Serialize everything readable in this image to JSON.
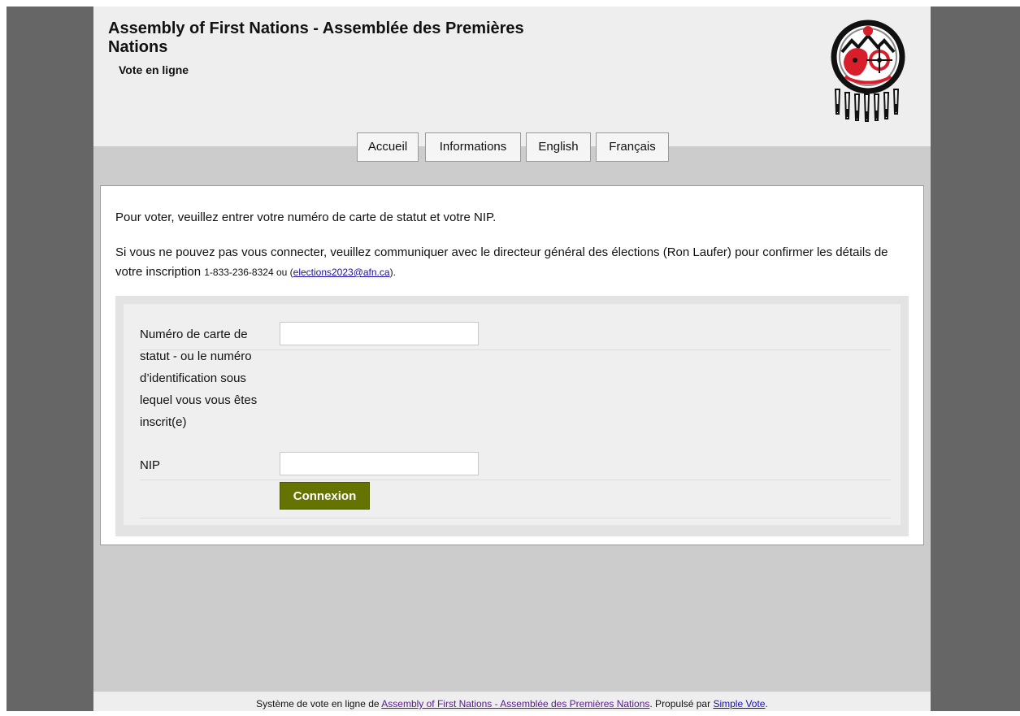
{
  "header": {
    "title": "Assembly of First Nations - Assemblée des Premières Nations",
    "subtitle": "Vote en ligne",
    "logo_icon": "afn-logo-icon"
  },
  "nav": {
    "items": [
      {
        "label": "Accueil"
      },
      {
        "label": "Informations"
      },
      {
        "label": "English"
      },
      {
        "label": "Français"
      }
    ]
  },
  "main": {
    "intro": "Pour voter, veuillez entrer votre numéro de carte de statut et votre NIP.",
    "help_text": "Si vous ne pouvez pas vous connecter, veuillez communiquer avec le directeur général des élections (Ron Laufer) pour confirmer les détails de votre inscription",
    "phone_text": "1-833-236-8324 ou (",
    "email_link": "elections2023@afn.ca",
    "email_close": ")."
  },
  "form": {
    "status_label_lines": [
      "Numéro de carte de",
      "statut - ou le numéro",
      "d’identification sous",
      "lequel vous vous êtes",
      "inscrit(e)"
    ],
    "status_value": "",
    "nip_label": "NIP",
    "nip_value": "",
    "submit_label": "Connexion"
  },
  "footer": {
    "prefix": "Système de vote en ligne de ",
    "org_link": "Assembly of First Nations - Assemblée des Premières Nations",
    "middle": ". Propulsé par ",
    "vendor_link": "Simple Vote",
    "suffix": "."
  },
  "colors": {
    "page_gray": "#cccccc",
    "side_gray": "#666666",
    "button_green": "#657400",
    "logo_red": "#d81e2a"
  }
}
